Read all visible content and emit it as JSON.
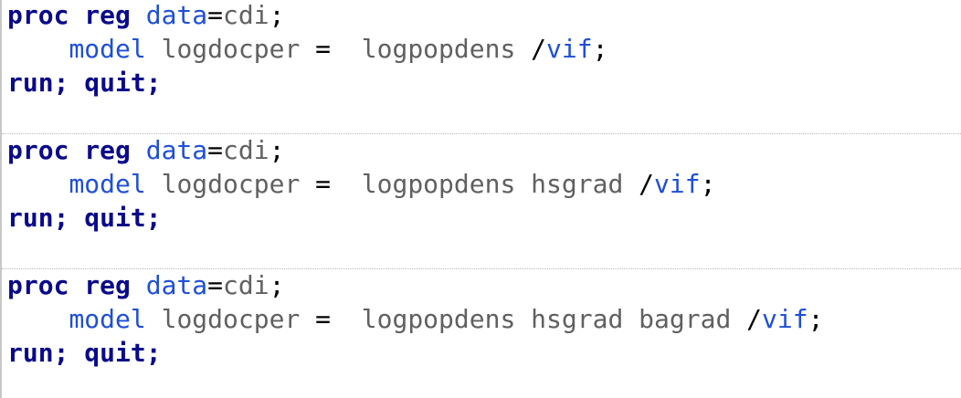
{
  "code_blocks": [
    {
      "line1": {
        "proc": "proc",
        "reg": "reg",
        "data_opt": "data",
        "eq": "=",
        "dataset": "cdi",
        "semi": ";"
      },
      "line2": {
        "indent": "    ",
        "model": "model",
        "response": "logdocper",
        "eq": " =  ",
        "predictors": "logpopdens",
        "slash": " /",
        "vif": "vif",
        "semi": ";"
      },
      "line3": {
        "run": "run",
        "semi1": ";",
        "quit": "quit",
        "semi2": ";"
      }
    },
    {
      "line1": {
        "proc": "proc",
        "reg": "reg",
        "data_opt": "data",
        "eq": "=",
        "dataset": "cdi",
        "semi": ";"
      },
      "line2": {
        "indent": "    ",
        "model": "model",
        "response": "logdocper",
        "eq": " =  ",
        "predictors": "logpopdens hsgrad",
        "slash": " /",
        "vif": "vif",
        "semi": ";"
      },
      "line3": {
        "run": "run",
        "semi1": ";",
        "quit": "quit",
        "semi2": ";"
      }
    },
    {
      "line1": {
        "proc": "proc",
        "reg": "reg",
        "data_opt": "data",
        "eq": "=",
        "dataset": "cdi",
        "semi": ";"
      },
      "line2": {
        "indent": "    ",
        "model": "model",
        "response": "logdocper",
        "eq": " =  ",
        "predictors": "logpopdens hsgrad bagrad",
        "slash": " /",
        "vif": "vif",
        "semi": ";"
      },
      "line3": {
        "run": "run",
        "semi1": ";",
        "quit": "quit",
        "semi2": ";"
      }
    }
  ],
  "colors": {
    "keyword": "#0a0a8a",
    "option": "#1e4fd8",
    "identifier": "#606060",
    "punctuation": "#000000",
    "separator": "#b8b8b8",
    "left_border": "#c8c8c8"
  }
}
